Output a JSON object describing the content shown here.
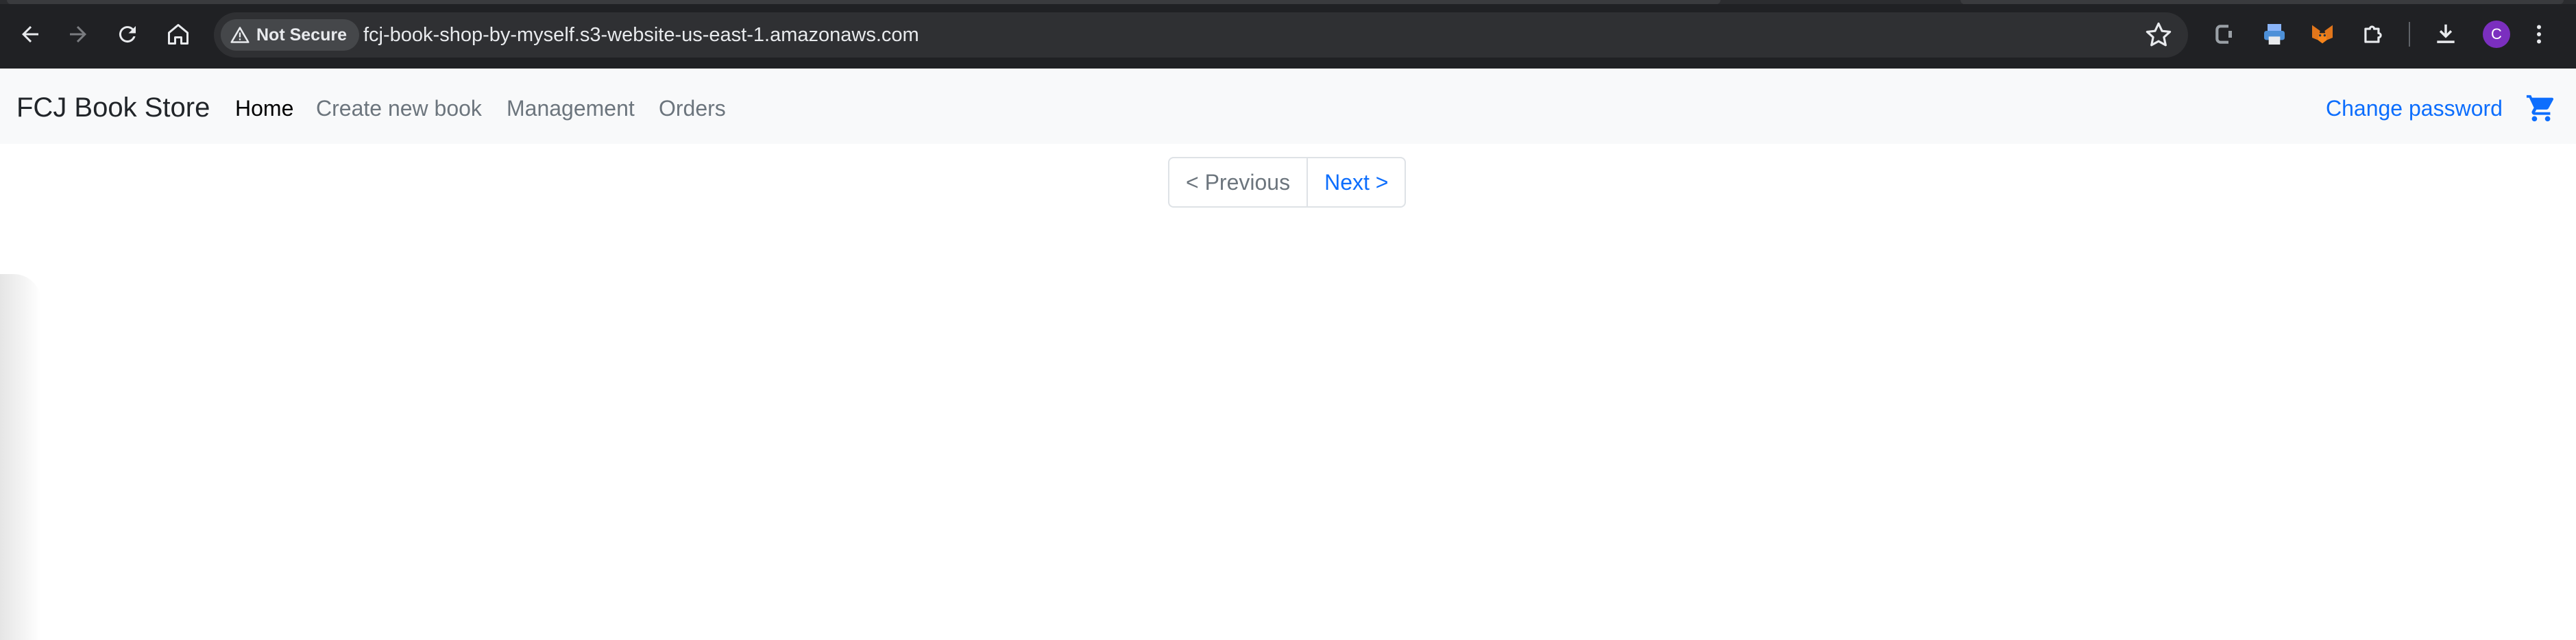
{
  "browser": {
    "security_label": "Not Secure",
    "url": "fcj-book-shop-by-myself.s3-website-us-east-1.amazonaws.com",
    "profile_initial": "C",
    "icons": [
      "back-icon",
      "forward-icon",
      "reload-icon",
      "home-icon",
      "warning-icon",
      "star-icon",
      "extension-c-icon",
      "printer-icon",
      "metamask-fox-icon",
      "puzzle-icon",
      "download-icon",
      "kebab-menu-icon"
    ]
  },
  "navbar": {
    "brand": "FCJ Book Store",
    "links": [
      {
        "label": "Home",
        "active": true
      },
      {
        "label": "Create new book",
        "active": false
      },
      {
        "label": "Management",
        "active": false
      },
      {
        "label": "Orders",
        "active": false
      }
    ],
    "change_password": "Change password",
    "cart_icon": "cart-icon"
  },
  "pagination": {
    "previous_label": "< Previous",
    "next_label": "Next >"
  },
  "colors": {
    "chrome_bg": "#202124",
    "navbar_bg": "#f8f9fa",
    "link_blue": "#0d6efd",
    "muted": "#6c757d",
    "avatar": "#7b2fbf"
  }
}
